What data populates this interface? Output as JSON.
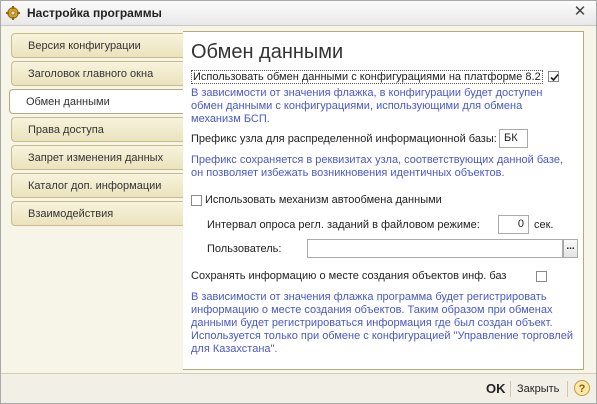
{
  "window": {
    "title": "Настройка программы",
    "close_glyph": "✕",
    "icon": "gear-icon"
  },
  "sidebar": {
    "items": [
      {
        "label": "Версия конфигурации",
        "active": false
      },
      {
        "label": "Заголовок главного окна",
        "active": false
      },
      {
        "label": "Обмен данными",
        "active": true
      },
      {
        "label": "Права доступа",
        "active": false
      },
      {
        "label": "Запрет изменения данных",
        "active": false
      },
      {
        "label": "Каталог доп. информации",
        "active": false
      },
      {
        "label": "Взаимодействия",
        "active": false
      }
    ]
  },
  "main": {
    "title": "Обмен данными",
    "use_exchange": {
      "label": "Использовать обмен данными с конфигурациями на платформе 8.2",
      "checked": true
    },
    "use_exchange_hint": "В зависимости от значения флажка, в конфигурации будет доступен обмен данными с конфигурациями, использующими для обмена механизм БСП.",
    "prefix": {
      "label": "Префикс узла для распределенной информационной базы:",
      "value": "БК"
    },
    "prefix_hint": "Префикс сохраняется в реквизитах узла, соответствующих данной базе, он позволяет избежать возникновения идентичных объектов.",
    "auto_exchange": {
      "label": "Использовать механизм автообмена данными",
      "checked": false
    },
    "interval": {
      "label": "Интервал опроса регл. заданий в файловом режиме:",
      "value": "0",
      "unit": "сек."
    },
    "user": {
      "label": "Пользователь:",
      "value": "",
      "button": "..."
    },
    "save_info": {
      "label": "Сохранять информацию о месте создания объектов инф. баз",
      "checked": false
    },
    "save_info_hint": "В зависимости от значения флажка программа будет регистрировать информацию о месте создания объектов. Таким образом при обменах данными будет регистрироваться информация где был создан объект. Используется только при обмене с конфигурацией \"Управление торговлей для Казахстана\"."
  },
  "footer": {
    "ok": "OK",
    "close": "Закрыть",
    "help": "?"
  },
  "colors": {
    "hint_text": "#4a58c8",
    "window_bg": "#f7f4e8",
    "tab_border": "#b5aa80"
  }
}
